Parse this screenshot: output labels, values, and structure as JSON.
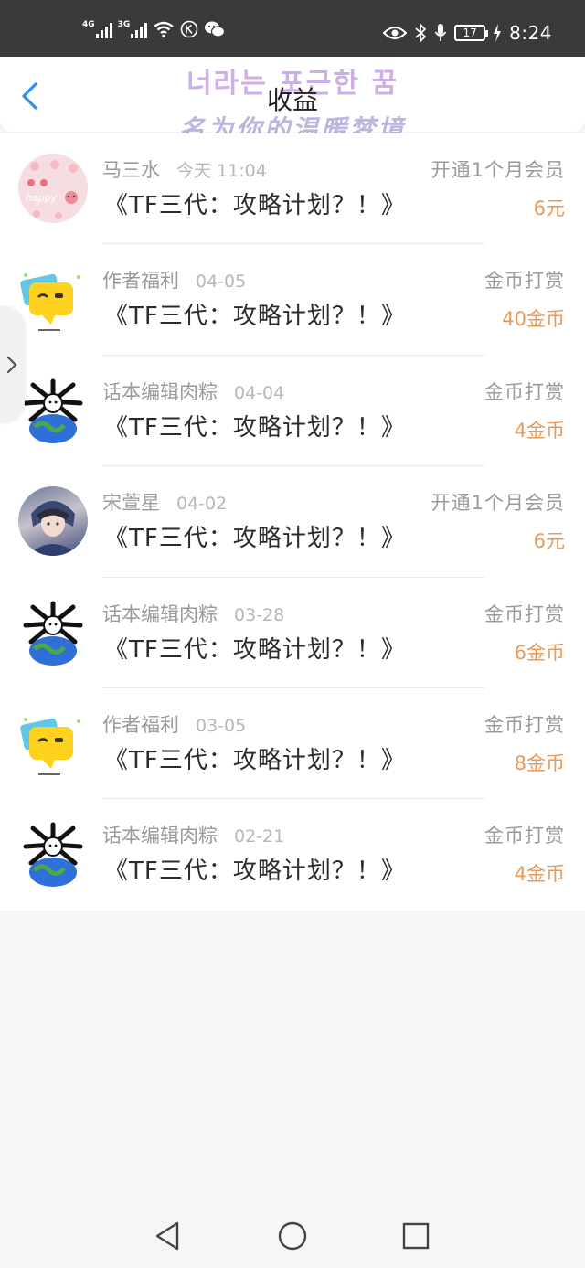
{
  "status_bar": {
    "net1": "4G",
    "net2": "3G",
    "battery": "17",
    "time": "8:24",
    "icons": [
      "signal-icon",
      "wifi-icon",
      "k-icon",
      "wechat-icon",
      "eye-icon",
      "bluetooth-icon",
      "mic-icon",
      "battery-icon",
      "charging-icon"
    ]
  },
  "header": {
    "title": "收益",
    "watermark_line1": "너라는 포근한 꿈",
    "watermark_line2": "名为你的温暖梦境"
  },
  "items": [
    {
      "name": "马三水",
      "date": "今天 11:04",
      "book": "《TF三代：攻略计划？！》",
      "type": "开通1个月会员",
      "amount": "6元",
      "avatar": "happy"
    },
    {
      "name": "作者福利",
      "date": "04-05",
      "book": "《TF三代：攻略计划？！》",
      "type": "金币打赏",
      "amount": "40金币",
      "avatar": "chat"
    },
    {
      "name": "话本编辑肉粽",
      "date": "04-04",
      "book": "《TF三代：攻略计划？！》",
      "type": "金币打赏",
      "amount": "4金币",
      "avatar": "globe"
    },
    {
      "name": "宋萱星",
      "date": "04-02",
      "book": "《TF三代：攻略计划？！》",
      "type": "开通1个月会员",
      "amount": "6元",
      "avatar": "girl"
    },
    {
      "name": "话本编辑肉粽",
      "date": "03-28",
      "book": "《TF三代：攻略计划？！》",
      "type": "金币打赏",
      "amount": "6金币",
      "avatar": "globe"
    },
    {
      "name": "作者福利",
      "date": "03-05",
      "book": "《TF三代：攻略计划？！》",
      "type": "金币打赏",
      "amount": "8金币",
      "avatar": "chat"
    },
    {
      "name": "话本编辑肉粽",
      "date": "02-21",
      "book": "《TF三代：攻略计划？！》",
      "type": "金币打赏",
      "amount": "4金币",
      "avatar": "globe"
    }
  ],
  "colors": {
    "accent_blue": "#2f8ff0",
    "amount_orange": "#e89a5a",
    "status_bar": "#3a3a3a"
  }
}
